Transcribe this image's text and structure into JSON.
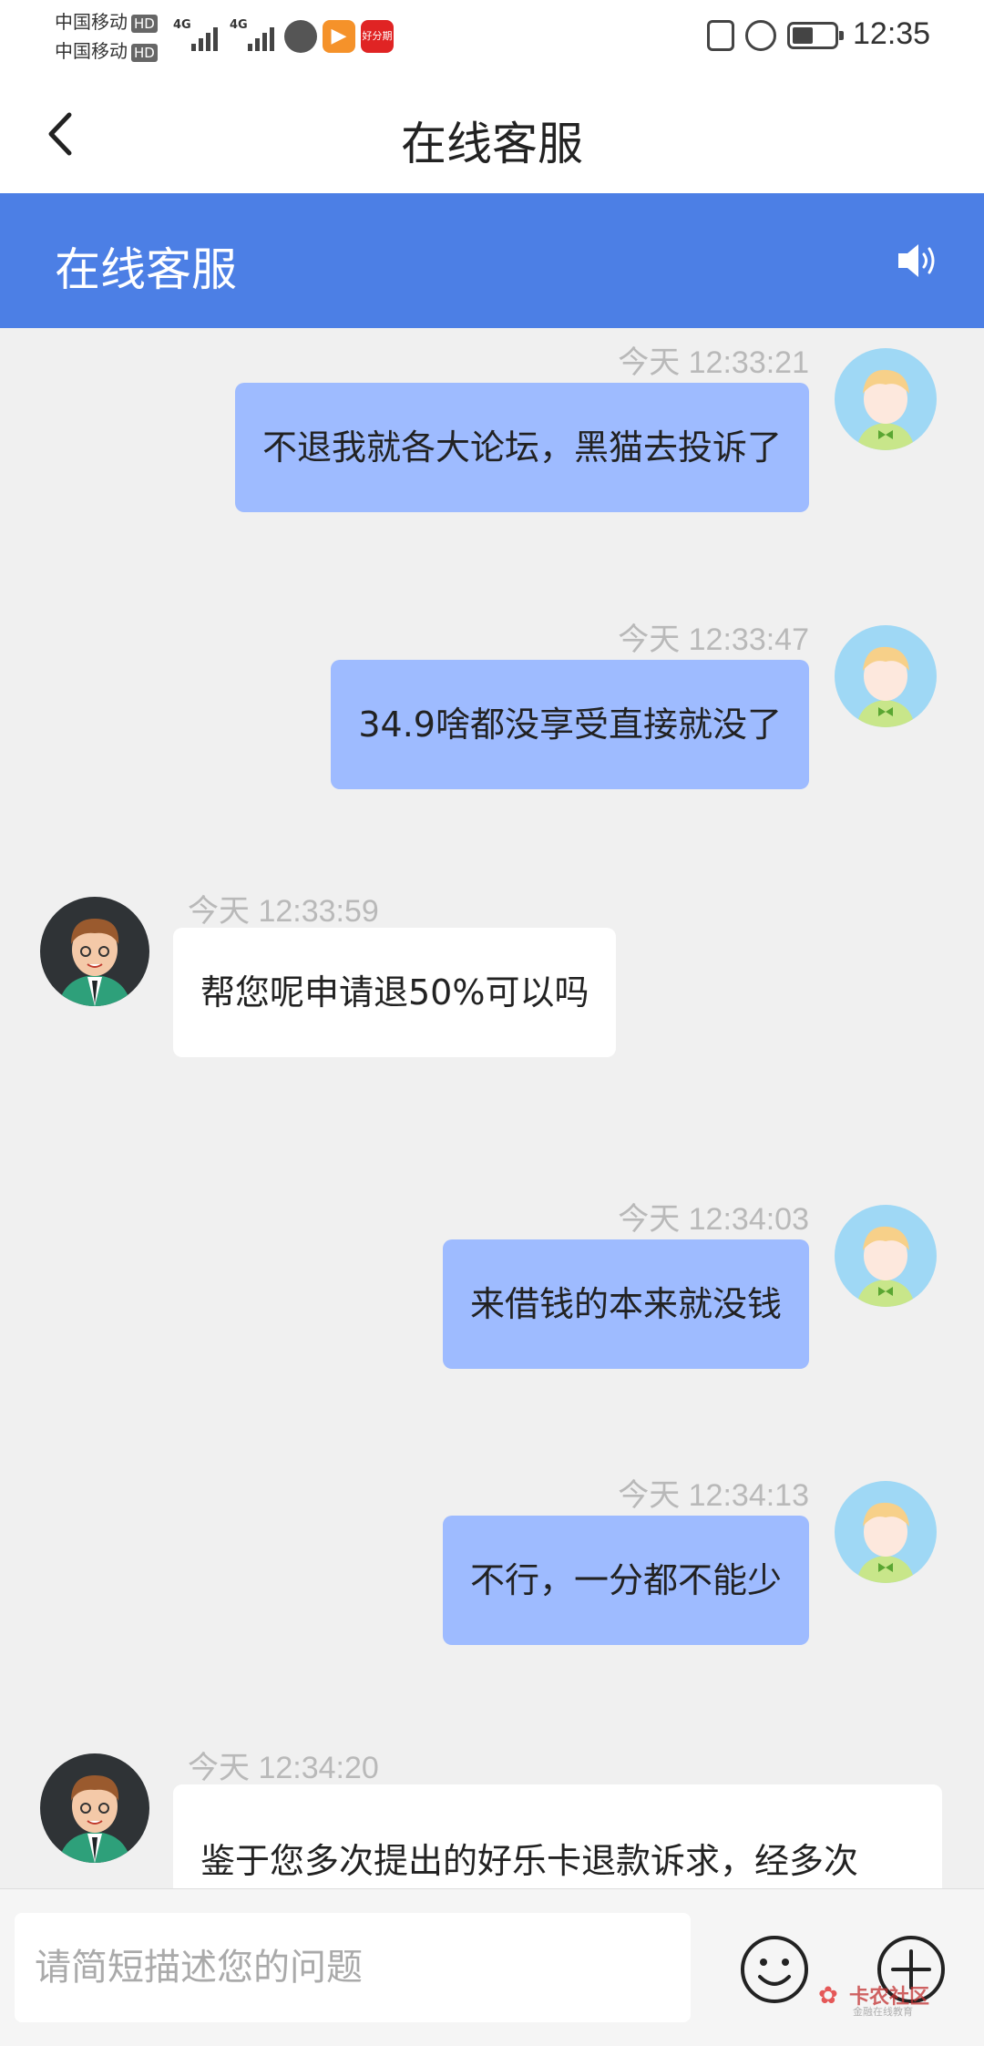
{
  "status_bar": {
    "carrier_1": "中国移动",
    "carrier_2": "中国移动",
    "hd_badge": "HD",
    "network_1": "4G",
    "network_2": "4G",
    "red_app_label": "好分期",
    "time": "12:35",
    "battery_level_percent": 45
  },
  "nav": {
    "title": "在线客服"
  },
  "chat_header": {
    "title": "在线客服"
  },
  "messages": [
    {
      "side": "right",
      "time": "今天 12:33:21",
      "text": "不退我就各大论坛，黑猫去投诉了"
    },
    {
      "side": "right",
      "time": "今天 12:33:47",
      "text": "34.9啥都没享受直接就没了"
    },
    {
      "side": "left",
      "time": "今天 12:33:59",
      "text": "帮您呢申请退50%可以吗"
    },
    {
      "side": "right",
      "time": "今天 12:34:03",
      "text": "来借钱的本来就没钱"
    },
    {
      "side": "right",
      "time": "今天 12:34:13",
      "text": "不行，一分都不能少"
    },
    {
      "side": "left",
      "time": "今天 12:34:20",
      "text": "鉴于您多次提出的好乐卡退款诉求，经多次"
    }
  ],
  "input": {
    "placeholder": "请简短描述您的问题"
  },
  "watermark": {
    "title": "卡农社区",
    "subtitle": "金融在线教育"
  },
  "colors": {
    "header_blue": "#4c7fe5",
    "user_bubble": "#9ebbff",
    "agent_bubble": "#ffffff",
    "background": "#f0f0f0"
  }
}
